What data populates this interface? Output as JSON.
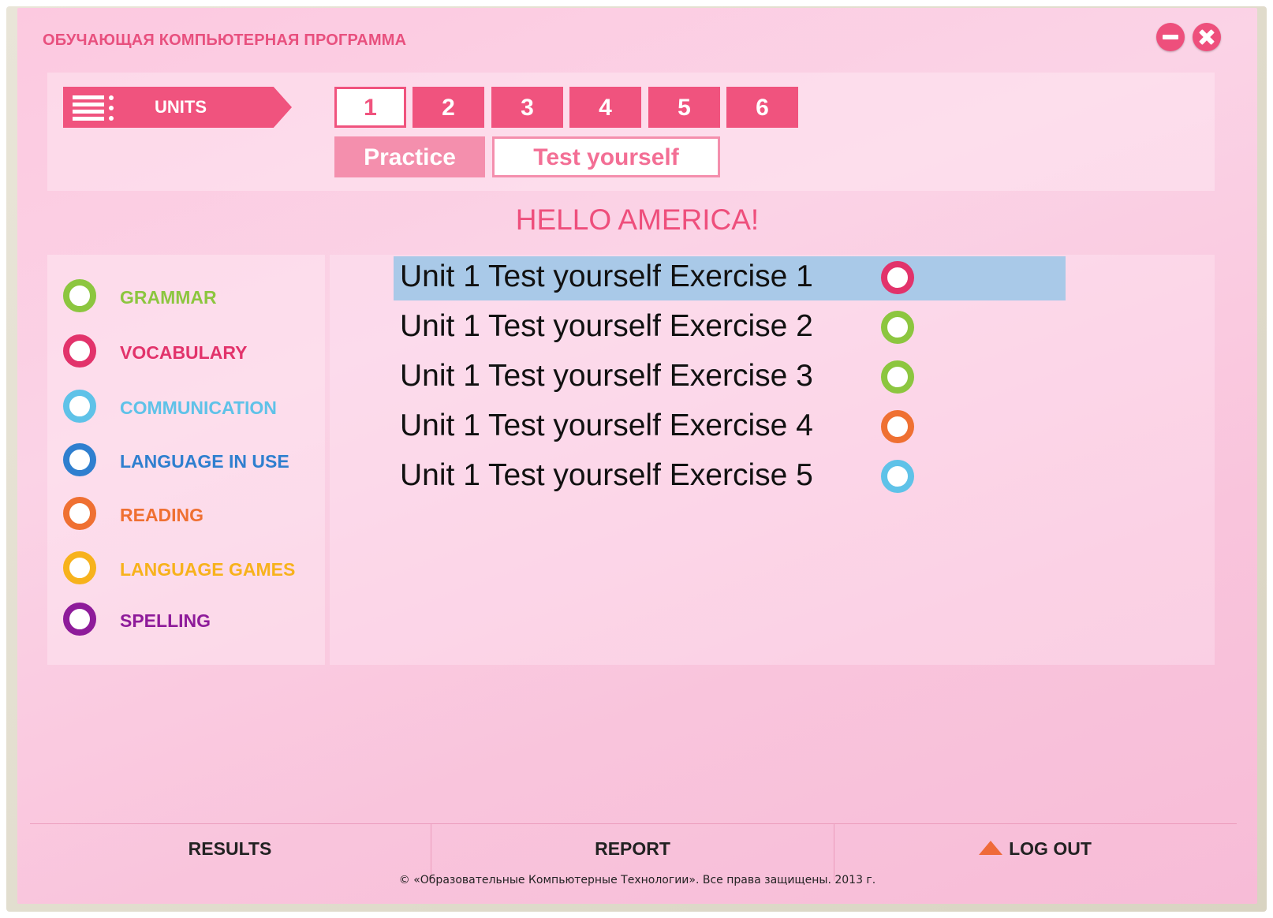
{
  "app": {
    "title": "ОБУЧАЮЩАЯ КОМПЬЮТЕРНАЯ ПРОГРАММА",
    "accent_color": "#f0537e"
  },
  "units_menu": {
    "label": "UNITS",
    "icon": "menu-icon"
  },
  "unit_tabs": [
    {
      "label": "1",
      "active": true
    },
    {
      "label": "2",
      "active": false
    },
    {
      "label": "3",
      "active": false
    },
    {
      "label": "4",
      "active": false
    },
    {
      "label": "5",
      "active": false
    },
    {
      "label": "6",
      "active": false
    }
  ],
  "mode_tabs": {
    "practice": "Practice",
    "test_yourself": "Test yourself",
    "selected": "Test yourself"
  },
  "unit_title": "HELLO AMERICA!",
  "categories": [
    {
      "label": "GRAMMAR",
      "color": "#8cc63f"
    },
    {
      "label": "VOCABULARY",
      "color": "#e2336b"
    },
    {
      "label": "COMMUNICATION",
      "color": "#5fc2e8"
    },
    {
      "label": "LANGUAGE IN USE",
      "color": "#2f7fcf"
    },
    {
      "label": "READING",
      "color": "#ef7032"
    },
    {
      "label": "LANGUAGE GAMES",
      "color": "#f7b21c"
    },
    {
      "label": "SPELLING",
      "color": "#8e1b9a"
    }
  ],
  "exercises": [
    {
      "label": "Unit 1 Test yourself Exercise 1",
      "color": "#e2336b",
      "selected": true
    },
    {
      "label": "Unit 1 Test yourself Exercise 2",
      "color": "#8cc63f",
      "selected": false
    },
    {
      "label": "Unit 1 Test yourself Exercise 3",
      "color": "#8cc63f",
      "selected": false
    },
    {
      "label": "Unit 1 Test yourself Exercise 4",
      "color": "#ef7032",
      "selected": false
    },
    {
      "label": "Unit 1 Test yourself Exercise 5",
      "color": "#5fc2e8",
      "selected": false
    }
  ],
  "footer": {
    "results": "RESULTS",
    "report": "REPORT",
    "logout": "LOG OUT",
    "copyright": "© «Образовательные Компьютерные Технологии». Все права защищены. 2013 г."
  }
}
